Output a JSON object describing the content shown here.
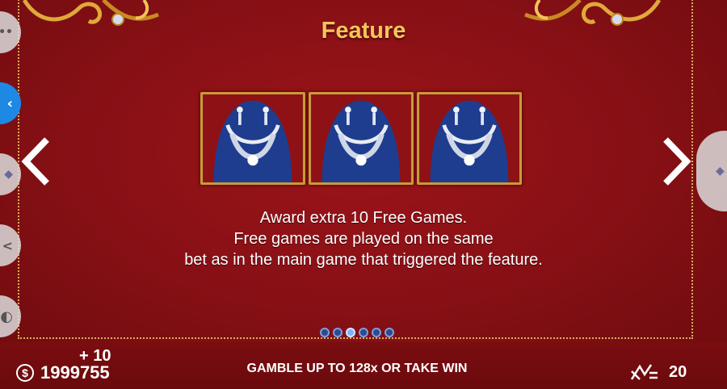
{
  "paytable": {
    "title": "Feature",
    "description_lines": [
      "Award extra 10 Free Games.",
      "Free games are played on the same",
      "bet as in the main game that triggered the feature."
    ],
    "symbol": "necklace-symbol",
    "symbol_count": 3,
    "page_count": 6,
    "active_page": 3
  },
  "footer": {
    "win_increment": "+ 10",
    "balance": "1999755",
    "currency_icon": "$",
    "gamble_text": "GAMBLE UP TO 128x OR TAKE WIN",
    "lines_count": "20"
  },
  "side_controls": [
    "menu-dots-icon",
    "back-chevron-icon",
    "gem-icon",
    "share-icon",
    "power-icon"
  ],
  "colors": {
    "background": "#8a1015",
    "title": "#f4c65b",
    "frame_gold": "#c99a3a",
    "page_dot_active": "#7fb0ff"
  }
}
